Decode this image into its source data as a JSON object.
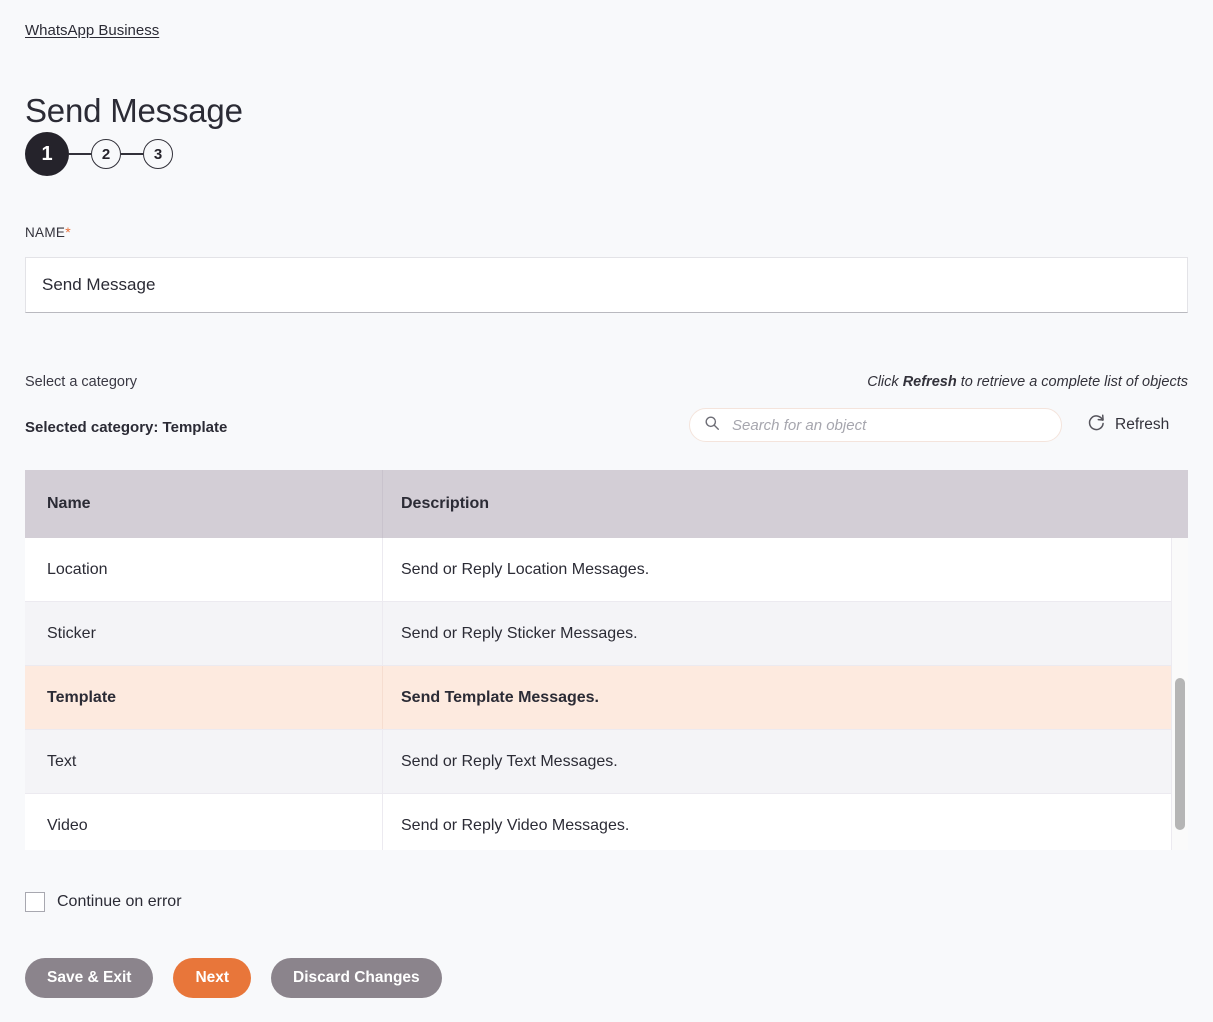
{
  "breadcrumb": {
    "label": "WhatsApp Business"
  },
  "header": {
    "title": "Send Message"
  },
  "stepper": {
    "steps": [
      {
        "label": "1",
        "state": "current"
      },
      {
        "label": "2",
        "state": "upcoming"
      },
      {
        "label": "3",
        "state": "upcoming"
      }
    ]
  },
  "name_field": {
    "label": "NAME",
    "required_marker": "*",
    "value": "Send Message",
    "placeholder": "Send Message"
  },
  "category": {
    "select_label": "Select a category",
    "selected_label": "Selected category: Template",
    "hint_prefix": "Click ",
    "hint_bold": "Refresh",
    "hint_suffix": " to retrieve a complete list of objects"
  },
  "search": {
    "placeholder": "Search for an object",
    "value": "",
    "icon": "search-icon"
  },
  "refresh": {
    "label": "Refresh",
    "icon": "refresh-icon"
  },
  "table": {
    "columns": [
      "Name",
      "Description"
    ],
    "rows": [
      {
        "name": "Location",
        "description": "Send or Reply Location Messages.",
        "selected": false
      },
      {
        "name": "Sticker",
        "description": "Send or Reply Sticker Messages.",
        "selected": false
      },
      {
        "name": "Template",
        "description": "Send Template Messages.",
        "selected": true
      },
      {
        "name": "Text",
        "description": "Send or Reply Text Messages.",
        "selected": false
      },
      {
        "name": "Video",
        "description": "Send or Reply Video Messages.",
        "selected": false
      }
    ]
  },
  "continue_on_error": {
    "label": "Continue on error",
    "checked": false
  },
  "footer": {
    "save_exit_label": "Save & Exit",
    "next_label": "Next",
    "discard_label": "Discard Changes"
  },
  "colors": {
    "page_background": "#f8f9fb",
    "accent_orange": "#e8763a",
    "button_grey": "#8b848c",
    "table_header": "#d3ced6",
    "selected_row": "#fdeadf",
    "step_current": "#25232b"
  }
}
